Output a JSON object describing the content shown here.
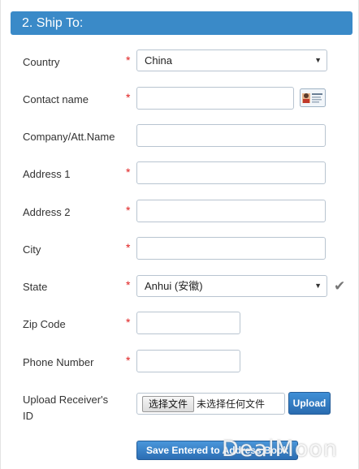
{
  "section": {
    "title": "2. Ship To:"
  },
  "fields": {
    "country": {
      "label": "Country",
      "required": "*",
      "value": "China"
    },
    "contact_name": {
      "label": "Contact name",
      "required": "*",
      "value": ""
    },
    "company": {
      "label": "Company/Att.Name",
      "value": ""
    },
    "address1": {
      "label": "Address 1",
      "required": "*",
      "value": ""
    },
    "address2": {
      "label": "Address 2",
      "required": "*",
      "value": ""
    },
    "city": {
      "label": "City",
      "required": "*",
      "value": ""
    },
    "state": {
      "label": "State",
      "required": "*",
      "value": "Anhui (安徽)"
    },
    "zip": {
      "label": "Zip Code",
      "required": "*",
      "value": ""
    },
    "phone": {
      "label": "Phone Number",
      "required": "*",
      "value": ""
    },
    "upload": {
      "label_line1": "Upload Receiver's",
      "label_line2": "ID",
      "choose_file_label": "选择文件",
      "file_status": "未选择任何文件",
      "upload_label": "Upload"
    }
  },
  "actions": {
    "save_label": "Save Entered to Address Book"
  },
  "watermark": "DealMoon",
  "icons": {
    "contact_card": "contact-card-icon",
    "dropdown_arrow": "chevron-down-icon",
    "state_valid": "checkmark-icon"
  },
  "colors": {
    "header": "#3a8ac8",
    "required": "#e02020",
    "button": "#2b6db3"
  }
}
